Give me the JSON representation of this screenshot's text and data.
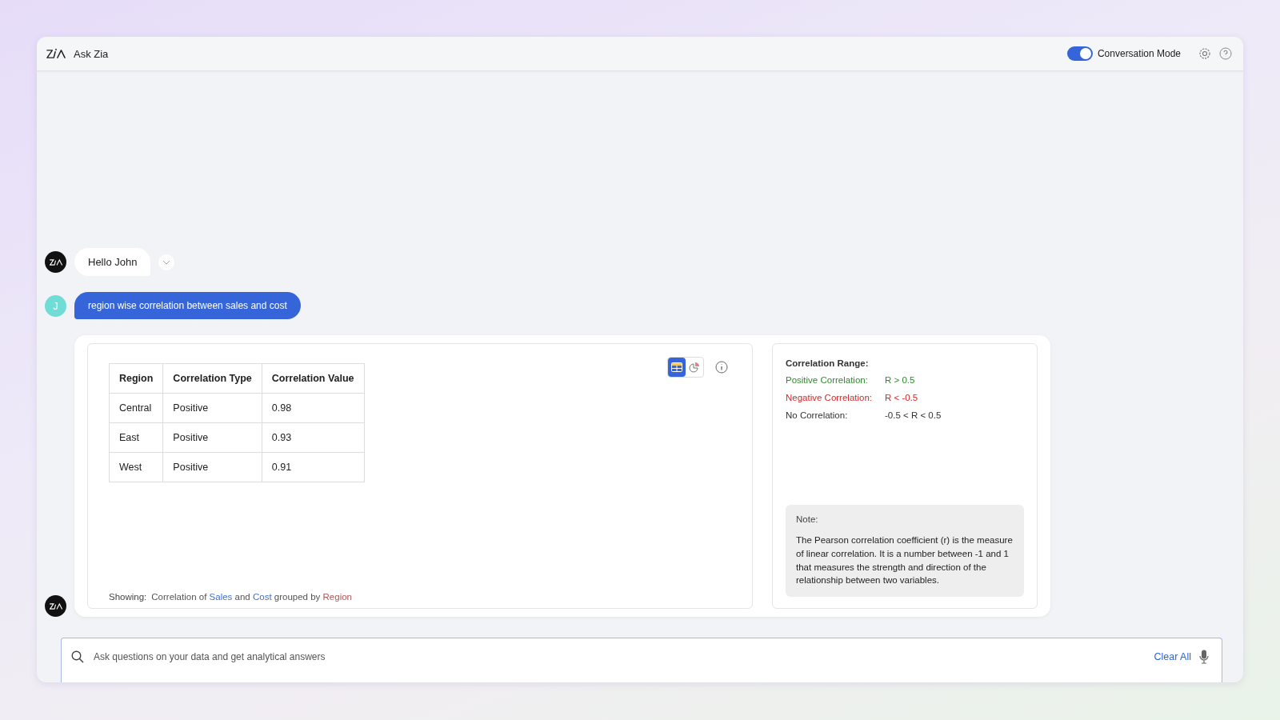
{
  "window": {
    "title": "Ask Zia"
  },
  "header": {
    "conversation_mode": {
      "label": "Conversation Mode",
      "on": true
    }
  },
  "messages": [
    {
      "kind": "bot",
      "text": "Hello John"
    },
    {
      "kind": "user",
      "avatar": "J",
      "text": "region wise correlation between sales and cost"
    }
  ],
  "result": {
    "view_toggle": [
      {
        "kind": "table",
        "selected": true
      },
      {
        "kind": "chart",
        "selected": false
      }
    ],
    "table": {
      "columns": [
        "Region",
        "Correlation Type",
        "Correlation Value"
      ],
      "rows": [
        [
          "Central",
          "Positive",
          "0.98"
        ],
        [
          "East",
          "Positive",
          "0.93"
        ],
        [
          "West",
          "Positive",
          "0.91"
        ]
      ]
    },
    "showing": {
      "label": "Showing:",
      "parts": [
        {
          "kind": "plain",
          "text": "Correlation of"
        },
        {
          "kind": "measure",
          "text": "Sales"
        },
        {
          "kind": "plain",
          "text": "and"
        },
        {
          "kind": "measure",
          "text": "Cost"
        },
        {
          "kind": "plain",
          "text": "grouped by"
        },
        {
          "kind": "dimension",
          "text": "Region"
        }
      ]
    },
    "range": {
      "title": "Correlation Range:",
      "rows": [
        {
          "kind": "positive",
          "label": "Positive Correlation:",
          "value": "R > 0.5"
        },
        {
          "kind": "negative",
          "label": "Negative Correlation:",
          "value": "R < -0.5"
        },
        {
          "kind": "none",
          "label": "No Correlation:",
          "value": "-0.5 < R < 0.5"
        }
      ]
    },
    "note": {
      "title": "Note:",
      "text": "The Pearson correlation coefficient (r) is the measure of linear correlation. It is a number between -1 and 1 that measures the strength and direction of the relationship between two variables."
    }
  },
  "input": {
    "placeholder": "Ask questions on your data and get analytical answers",
    "clear_label": "Clear All"
  }
}
